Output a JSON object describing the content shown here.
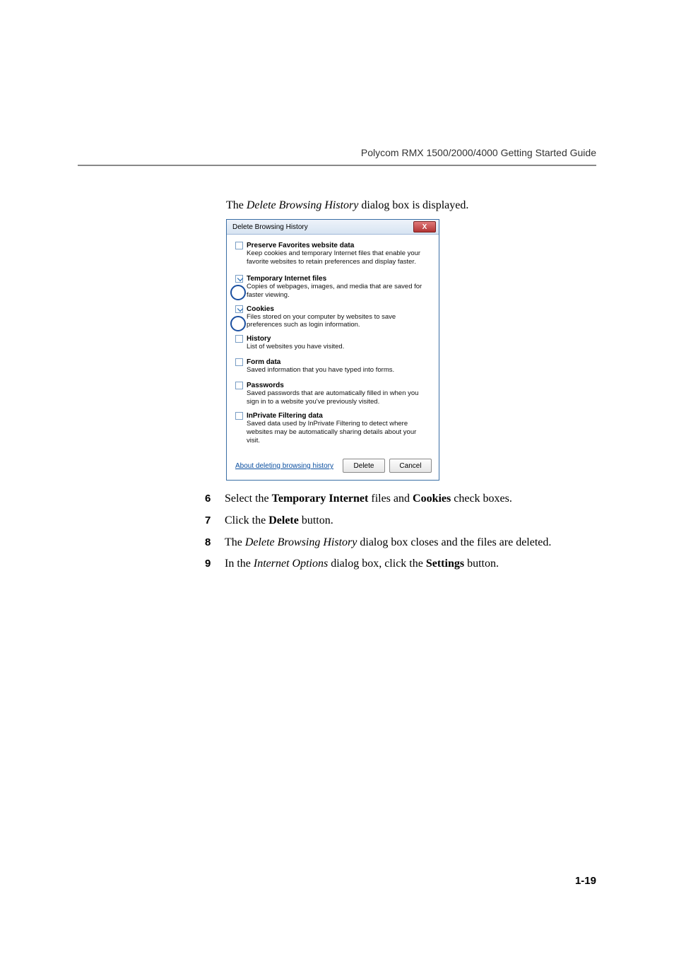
{
  "header": "Polycom RMX 1500/2000/4000 Getting Started Guide",
  "intro": {
    "prefix": "The ",
    "italic": "Delete Browsing History",
    "suffix": " dialog box is displayed."
  },
  "dialog": {
    "title": "Delete Browsing History",
    "close": "X",
    "groups": [
      {
        "checked": false,
        "label": "Preserve Favorites website data",
        "desc": "Keep cookies and temporary Internet files that enable your favorite websites to retain preferences and display faster."
      },
      {
        "checked": true,
        "label": "Temporary Internet files",
        "desc": "Copies of webpages, images, and media that are saved for faster viewing."
      },
      {
        "checked": true,
        "label": "Cookies",
        "desc": "Files stored on your computer by websites to save preferences such as login information."
      },
      {
        "checked": false,
        "label": "History",
        "desc": "List of websites you have visited."
      },
      {
        "checked": false,
        "label": "Form data",
        "desc": "Saved information that you have typed into forms."
      },
      {
        "checked": false,
        "label": "Passwords",
        "desc": "Saved passwords that are automatically filled in when you sign in to a website you've previously visited."
      },
      {
        "checked": false,
        "label": "InPrivate Filtering data",
        "desc": "Saved data used by InPrivate Filtering to detect where websites may be automatically sharing details about your visit."
      }
    ],
    "footer_link": "About deleting browsing history",
    "delete_btn": "Delete",
    "cancel_btn": "Cancel"
  },
  "steps": [
    {
      "num": "6",
      "pre": "Select the ",
      "b1": "Temporary Internet",
      "mid": " files and ",
      "b2": "Cookies",
      "post": " check boxes."
    },
    {
      "num": "7",
      "pre": "Click the ",
      "b1": "Delete",
      "mid": "",
      "b2": "",
      "post": " button."
    },
    {
      "num": "8",
      "pre": "The ",
      "i1": "Delete Browsing History",
      "post": " dialog box closes and the files are deleted."
    },
    {
      "num": "9",
      "pre": "In the ",
      "i1": "Internet Options",
      "mid": " dialog box, click the ",
      "b1": "Settings",
      "post": " button."
    }
  ],
  "pagenum": "1-19"
}
